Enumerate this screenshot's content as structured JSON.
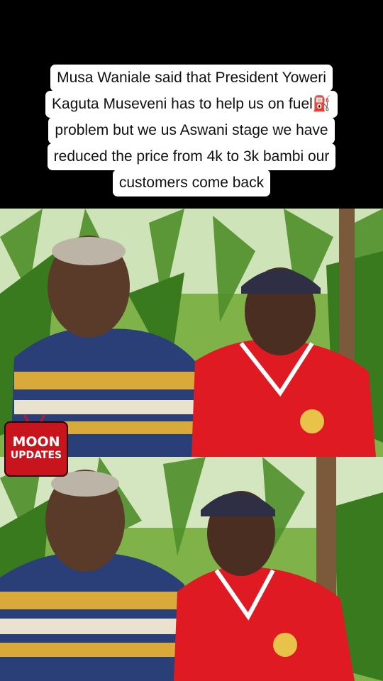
{
  "caption": {
    "lines": [
      "Musa Waniale said that President Yoweri",
      "Kaguta Museveni has to help us on fuel⛽",
      "problem but we us Aswani stage we have",
      "reduced the price from 4k to 3k bambi our",
      "customers come back"
    ]
  },
  "logo": {
    "line1": "MOON",
    "line2": "UPDATES"
  },
  "colors": {
    "background": "#000000",
    "caption_bg": "#ffffff",
    "logo_red": "#c8141c",
    "jersey_red": "#e01a22"
  }
}
